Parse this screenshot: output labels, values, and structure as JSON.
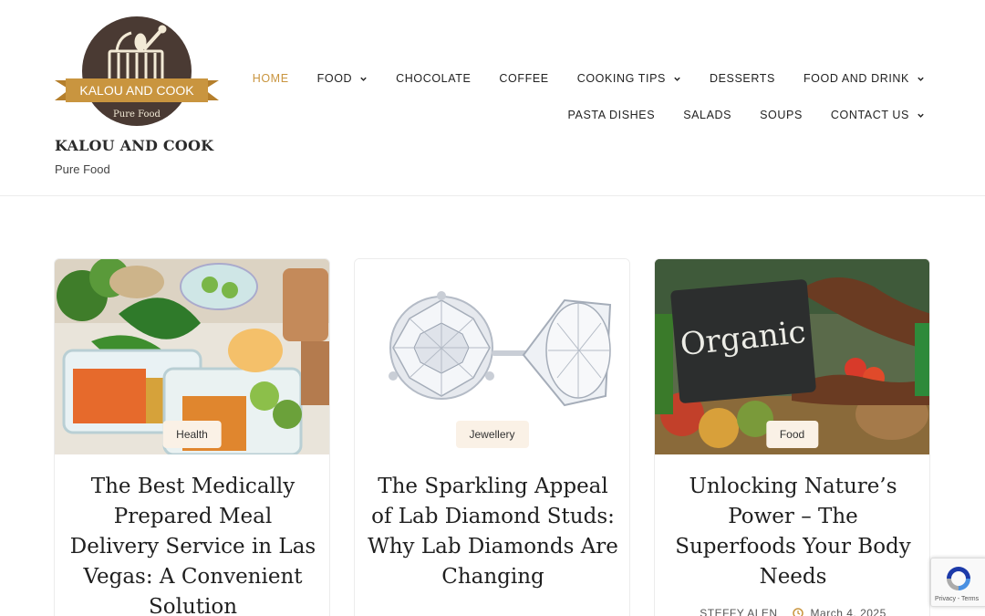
{
  "site": {
    "logo_main_text": "KALOU AND COOK",
    "logo_sub_text": "Pure Food",
    "title": "KALOU AND COOK",
    "tagline": "Pure Food"
  },
  "nav": {
    "row1": [
      {
        "label": "HOME",
        "active": true,
        "has_dropdown": false
      },
      {
        "label": "FOOD",
        "active": false,
        "has_dropdown": true
      },
      {
        "label": "CHOCOLATE",
        "active": false,
        "has_dropdown": false
      },
      {
        "label": "COFFEE",
        "active": false,
        "has_dropdown": false
      },
      {
        "label": "COOKING TIPS",
        "active": false,
        "has_dropdown": true
      },
      {
        "label": "DESSERTS",
        "active": false,
        "has_dropdown": false
      },
      {
        "label": "FOOD AND DRINK",
        "active": false,
        "has_dropdown": true
      }
    ],
    "row2": [
      {
        "label": "PASTA DISHES",
        "active": false,
        "has_dropdown": false
      },
      {
        "label": "SALADS",
        "active": false,
        "has_dropdown": false
      },
      {
        "label": "SOUPS",
        "active": false,
        "has_dropdown": false
      },
      {
        "label": "CONTACT US",
        "active": false,
        "has_dropdown": true
      }
    ]
  },
  "posts": [
    {
      "category": "Health",
      "title": "The Best Medically Prepared Meal Delivery Service in Las Vegas: A Convenient Solution",
      "image": "meal-prep-containers-image"
    },
    {
      "category": "Jewellery",
      "title": "The Sparkling Appeal of Lab Diamond Studs: Why Lab Diamonds Are Changing",
      "image": "diamond-stud-earrings-image"
    },
    {
      "category": "Food",
      "title": "Unlocking Nature’s Power –  The Superfoods Your Body Needs",
      "author": "STEFFY ALEN",
      "date": "March 4, 2025",
      "image": "organic-chalkboard-sign-image"
    }
  ],
  "recaptcha": {
    "footer_text": "Privacy - Terms"
  },
  "colors": {
    "accent": "#c9953f",
    "logo_circle": "#4a3a33",
    "logo_ribbon": "#c9953f",
    "badge_bg": "#faf1e6"
  }
}
